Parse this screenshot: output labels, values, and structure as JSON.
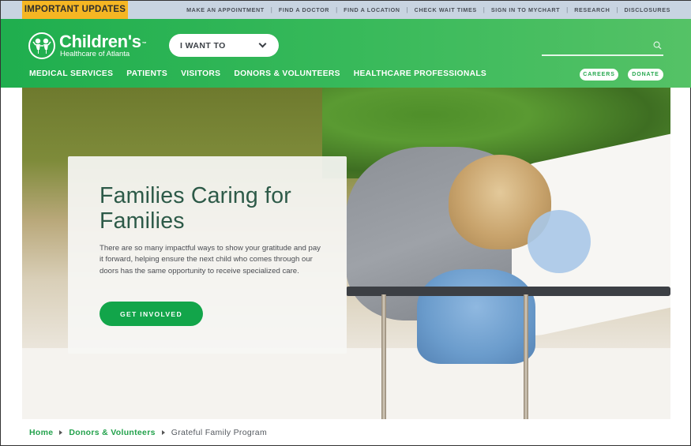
{
  "utility_bar": {
    "important_label": "IMPORTANT UPDATES",
    "links": [
      "MAKE AN APPOINTMENT",
      "FIND A DOCTOR",
      "FIND A LOCATION",
      "CHECK WAIT TIMES",
      "SIGN IN TO MYCHART",
      "RESEARCH",
      "DISCLOSURES"
    ],
    "separator": "|"
  },
  "header": {
    "logo": {
      "title": "Children's",
      "trademark": "™",
      "subtitle": "Healthcare of Atlanta",
      "icon": "children-holding-hands-icon"
    },
    "i_want_to": {
      "label": "I WANT TO",
      "icon": "chevron-down-icon"
    },
    "search": {
      "value": "",
      "placeholder": "",
      "icon": "search-icon"
    },
    "main_nav": [
      "MEDICAL SERVICES",
      "PATIENTS",
      "VISITORS",
      "DONORS & VOLUNTEERS",
      "HEALTHCARE PROFESSIONALS"
    ],
    "careers_label": "CAREERS",
    "donate_label": "DONATE"
  },
  "hero": {
    "title": "Families Caring for Families",
    "body": "There are so many impactful ways to show your gratitude and pay it forward, helping ensure the next child who comes through our doors has the same opportunity to receive specialized care.",
    "cta_label": "GET INVOLVED",
    "image_alt": "Mother hugging and kissing child in hospital bed"
  },
  "breadcrumb": {
    "items": [
      {
        "label": "Home",
        "link": true
      },
      {
        "label": "Donors & Volunteers",
        "link": true
      },
      {
        "label": "Grateful Family Program",
        "link": false
      }
    ]
  },
  "colors": {
    "brand_green": "#1fae4e",
    "brand_green_light": "#55c266",
    "cta_green": "#12a54a",
    "important_yellow": "#f5b623",
    "utility_bar_bg": "#c8d4e1",
    "hero_title": "#2d5a48"
  }
}
